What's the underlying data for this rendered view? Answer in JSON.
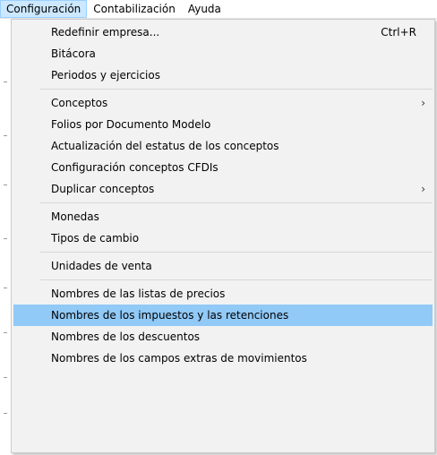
{
  "menubar": {
    "items": [
      {
        "label": "Configuración"
      },
      {
        "label": "Contabilización"
      },
      {
        "label": "Ayuda"
      }
    ]
  },
  "menu": {
    "redefinir_empresa": {
      "label": "Redefinir empresa...",
      "shortcut": "Ctrl+R"
    },
    "bitacora": {
      "label": "Bitácora"
    },
    "periodos": {
      "label": "Periodos y ejercicios"
    },
    "conceptos": {
      "label": "Conceptos",
      "arrow": "›"
    },
    "folios": {
      "label": "Folios por Documento Modelo"
    },
    "actualizacion": {
      "label": "Actualización del estatus de los conceptos"
    },
    "config_cfdis": {
      "label": "Configuración conceptos CFDIs"
    },
    "duplicar": {
      "label": "Duplicar conceptos",
      "arrow": "›"
    },
    "monedas": {
      "label": "Monedas"
    },
    "tipos_cambio": {
      "label": "Tipos de cambio"
    },
    "unidades_venta": {
      "label": "Unidades de venta"
    },
    "listas_precios": {
      "label": "Nombres de las listas de precios"
    },
    "impuestos": {
      "label": "Nombres de los impuestos y las retenciones"
    },
    "descuentos": {
      "label": "Nombres de los descuentos"
    },
    "campos_extras": {
      "label": "Nombres de los campos extras de movimientos"
    }
  },
  "colors": {
    "highlight": "#91c9f7",
    "menubar_open": "#cce8ff",
    "menu_bg": "#f2f2f2"
  }
}
